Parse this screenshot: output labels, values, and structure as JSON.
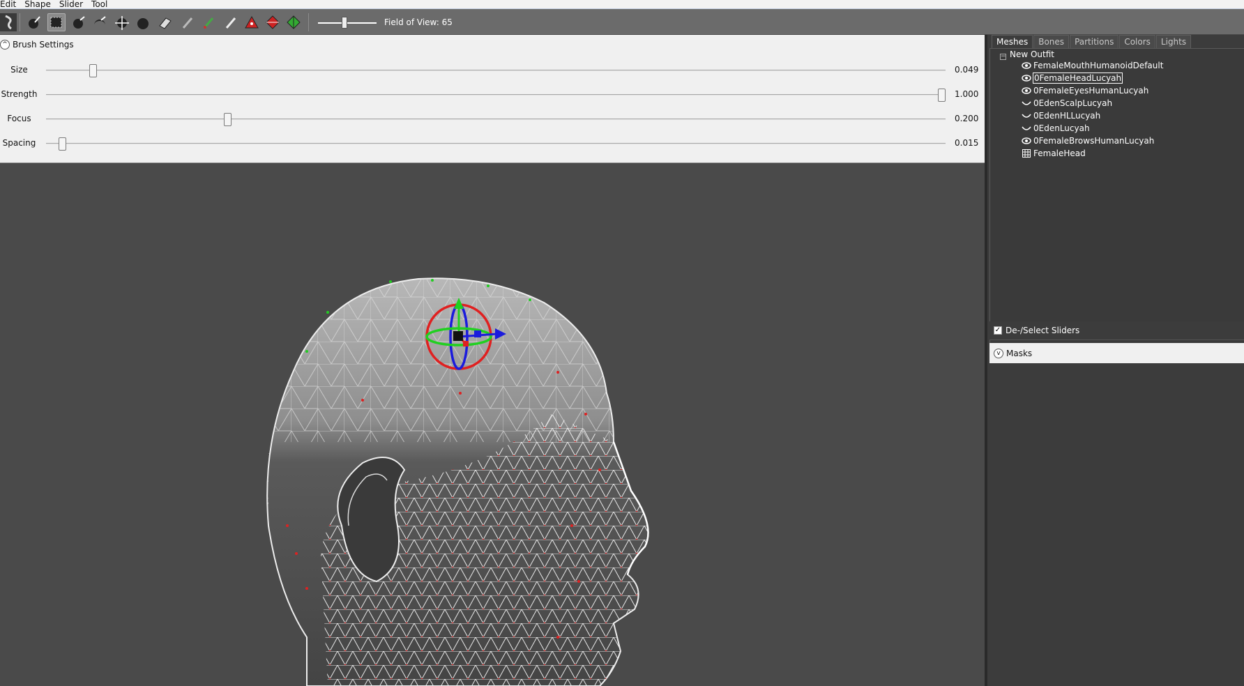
{
  "menubar": {
    "items": [
      "Edit",
      "Shape",
      "Slider",
      "Tool"
    ]
  },
  "toolbar": {
    "tools": [
      "logo-icon",
      "standard-brush-icon",
      "mask-brush-icon",
      "inflate-brush-icon",
      "deflate-brush-icon",
      "move-brush-icon",
      "smooth-brush-icon",
      "undiff-brush-icon",
      "weight-brush-icon",
      "color-brush-icon",
      "alpha-brush-icon",
      "collapse-vertex-icon",
      "flip-edge-icon",
      "split-edge-icon"
    ],
    "fov_label": "Field of View: 65",
    "fov_value": 65
  },
  "brush_settings": {
    "title": "Brush Settings",
    "sliders": [
      {
        "label": "Size",
        "value": "0.049",
        "fraction": 0.049
      },
      {
        "label": "Strength",
        "value": "1.000",
        "fraction": 1.0
      },
      {
        "label": "Focus",
        "value": "0.200",
        "fraction": 0.2
      },
      {
        "label": "Spacing",
        "value": "0.015",
        "fraction": 0.015
      }
    ]
  },
  "right_panel": {
    "tabs": [
      "Meshes",
      "Bones",
      "Partitions",
      "Colors",
      "Lights"
    ],
    "active_tab": "Meshes",
    "tree": {
      "root": "New Outfit",
      "items": [
        {
          "label": "FemaleMouthHumanoidDefault",
          "icon": "eye-visible-icon"
        },
        {
          "label": "0FemaleHeadLucyah",
          "icon": "eye-visible-icon",
          "selected": true
        },
        {
          "label": "0FemaleEyesHumanLucyah",
          "icon": "eye-visible-icon"
        },
        {
          "label": "0EdenScalpLucyah",
          "icon": "eye-hidden-icon"
        },
        {
          "label": "0EdenHLLucyah",
          "icon": "eye-hidden-icon"
        },
        {
          "label": "0EdenLucyah",
          "icon": "eye-hidden-icon"
        },
        {
          "label": "0FemaleBrowsHumanLucyah",
          "icon": "eye-visible-icon"
        },
        {
          "label": "FemaleHead",
          "icon": "wireframe-icon"
        }
      ]
    },
    "deselect_sliders": {
      "label": "De-/Select Sliders",
      "checked": true
    },
    "masks": {
      "label": "Masks"
    }
  },
  "viewport": {
    "background": "#4a4a4a",
    "mesh": "FemaleHead"
  }
}
